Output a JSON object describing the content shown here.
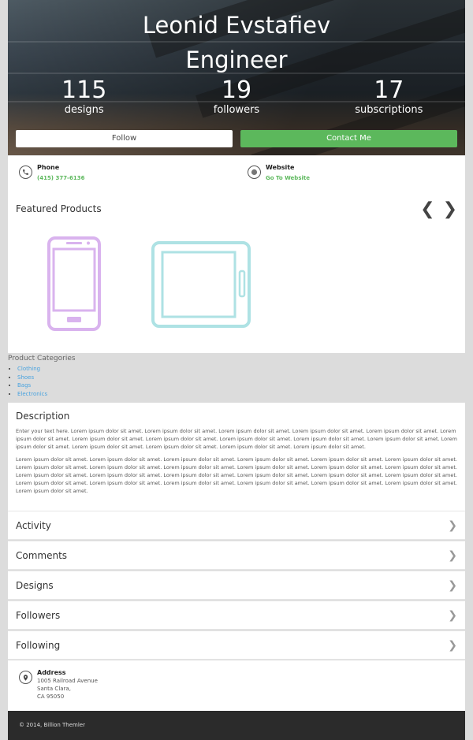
{
  "profile": {
    "name_line1": "Leonid Evstafiev",
    "name_line2": "Engineer",
    "stats": [
      {
        "value": "115",
        "label": "designs"
      },
      {
        "value": "19",
        "label": "followers"
      },
      {
        "value": "17",
        "label": "subscriptions"
      }
    ],
    "follow_label": "Follow",
    "contact_label": "Contact Me"
  },
  "contact": {
    "phone_title": "Phone",
    "phone_value": "(415) 377-6136",
    "website_title": "Website",
    "website_value": "Go To Website"
  },
  "featured": {
    "title": "Featured Products",
    "prev": "❮",
    "next": "❯",
    "colors": {
      "phone": "#d9b3ee",
      "tablet": "#aee2e4"
    }
  },
  "categories": {
    "title": "Product Categories",
    "items": [
      "Clothing",
      "Shoes",
      "Bags",
      "Electronics"
    ]
  },
  "description": {
    "title": "Description",
    "p1": "Enter your text here. Lorem ipsum dolor sit amet. Lorem ipsum dolor sit amet. Lorem ipsum dolor sit amet. Lorem ipsum dolor sit amet. Lorem ipsum dolor sit amet. Lorem ipsum dolor sit amet. Lorem ipsum dolor sit amet. Lorem ipsum dolor sit amet. Lorem ipsum dolor sit amet. Lorem ipsum dolor sit amet. Lorem ipsum dolor sit amet. Lorem ipsum dolor sit amet. Lorem ipsum dolor sit amet. Lorem ipsum dolor sit amet. Lorem ipsum dolor sit amet. Lorem ipsum dolor sit amet.",
    "p2": "Lorem ipsum dolor sit amet. Lorem ipsum dolor sit amet. Lorem ipsum dolor sit amet. Lorem ipsum dolor sit amet. Lorem ipsum dolor sit amet. Lorem ipsum dolor sit amet. Lorem ipsum dolor sit amet. Lorem ipsum dolor sit amet. Lorem ipsum dolor sit amet. Lorem ipsum dolor sit amet. Lorem ipsum dolor sit amet. Lorem ipsum dolor sit amet. Lorem ipsum dolor sit amet. Lorem ipsum dolor sit amet. Lorem ipsum dolor sit amet. Lorem ipsum dolor sit amet. Lorem ipsum dolor sit amet. Lorem ipsum dolor sit amet. Lorem ipsum dolor sit amet. Lorem ipsum dolor sit amet. Lorem ipsum dolor sit amet. Lorem ipsum dolor sit amet. Lorem ipsum dolor sit amet. Lorem ipsum dolor sit amet. Lorem ipsum dolor sit amet."
  },
  "accordion": {
    "chevron": "❯",
    "items": [
      "Activity",
      "Comments",
      "Designs",
      "Followers",
      "Following"
    ]
  },
  "address": {
    "title": "Address",
    "line1": "1005 Railroad Avenue",
    "line2": "Santa Clara,",
    "line3": "CA 95050"
  },
  "footer": {
    "text": "© 2014, Billion Themler"
  },
  "colors": {
    "accent_green": "#5cb85c",
    "link_blue": "#4aa3df"
  }
}
